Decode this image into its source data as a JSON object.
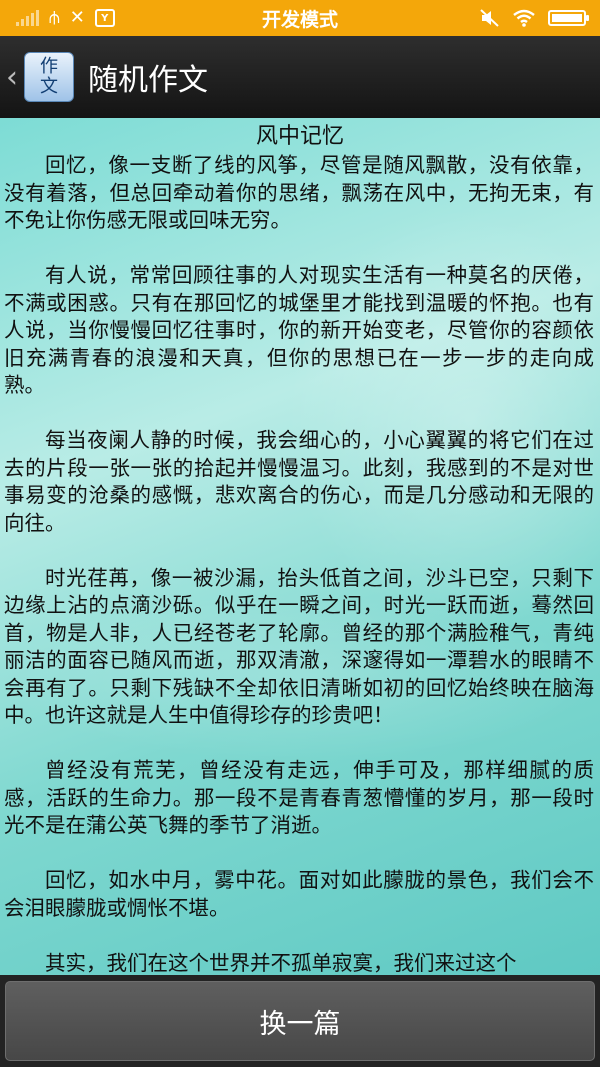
{
  "status_bar": {
    "title": "开发模式",
    "icons": [
      "signal-icon",
      "usb-icon",
      "tools-icon",
      "app-badge-icon",
      "mute-icon",
      "wifi-icon",
      "battery-icon"
    ],
    "battery_level": 1.0,
    "colors": {
      "background": "#f4a70a"
    }
  },
  "action_bar": {
    "app_icon_text": [
      "作",
      "文"
    ],
    "title": "随机作文"
  },
  "article": {
    "title": "风中记忆",
    "paragraphs": [
      "回忆，像一支断了线的风筝，尽管是随风飘散，没有依靠，没有着落，但总回牵动着你的思绪，飘荡在风中，无拘无束，有不免让你伤感无限或回味无穷。",
      "有人说，常常回顾往事的人对现实生活有一种莫名的厌倦，不满或困惑。只有在那回忆的城堡里才能找到温暖的怀抱。也有人说，当你慢慢回忆往事时，你的新开始变老，尽管你的容颜依旧充满青春的浪漫和天真，但你的思想已在一步一步的走向成熟。",
      "每当夜阑人静的时候，我会细心的，小心翼翼的将它们在过去的片段一张一张的拾起并慢慢温习。此刻，我感到的不是对世事易变的沧桑的感慨，悲欢离合的伤心，而是几分感动和无限的向往。",
      "时光荏苒，像一被沙漏，抬头低首之间，沙斗已空，只剩下边缘上沾的点滴沙砾。似乎在一瞬之间，时光一跃而逝，蓦然回首，物是人非，人已经苍老了轮廓。曾经的那个满脸稚气，青纯丽洁的面容已随风而逝，那双清澈，深邃得如一潭碧水的眼睛不会再有了。只剩下残缺不全却依旧清晰如初的回忆始终映在脑海中。也许这就是人生中值得珍存的珍贵吧！",
      "曾经没有荒芜，曾经没有走远，伸手可及，那样细腻的质感，活跃的生命力。那一段不是青春青葱懵懂的岁月，那一段时光不是在蒲公英飞舞的季节了消逝。",
      "回忆，如水中月，雾中花。面对如此朦胧的景色，我们会不会泪眼朦胧或惆怅不堪。",
      "其实，我们在这个世界并不孤单寂寞，我们来过这个"
    ]
  },
  "bottom": {
    "next_label": "换一篇"
  }
}
